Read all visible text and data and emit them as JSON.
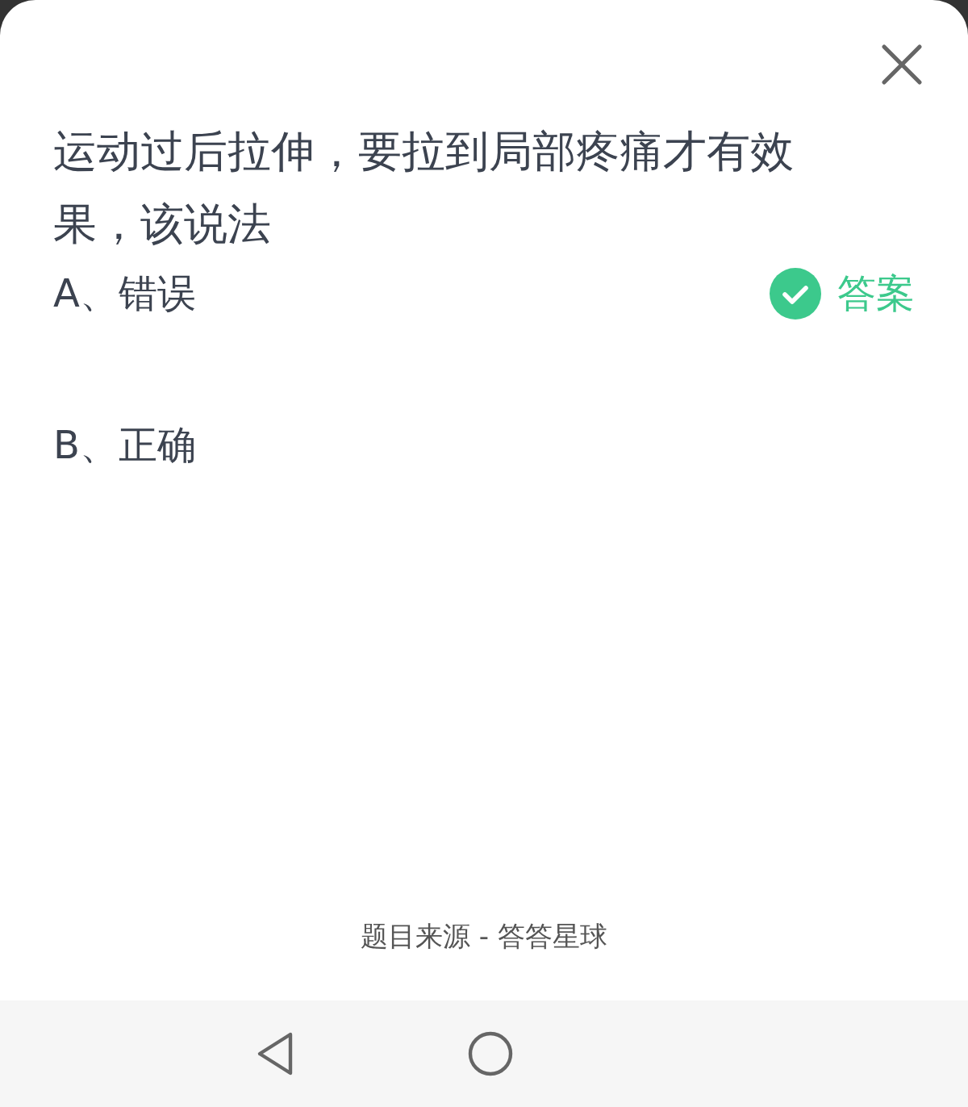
{
  "question": "运动过后拉伸，要拉到局部疼痛才有效果，该说法",
  "options": [
    {
      "label": "A、错误",
      "correct": true,
      "badge": "答案"
    },
    {
      "label": "B、正确",
      "correct": false
    }
  ],
  "source": "题目来源 - 答答星球"
}
